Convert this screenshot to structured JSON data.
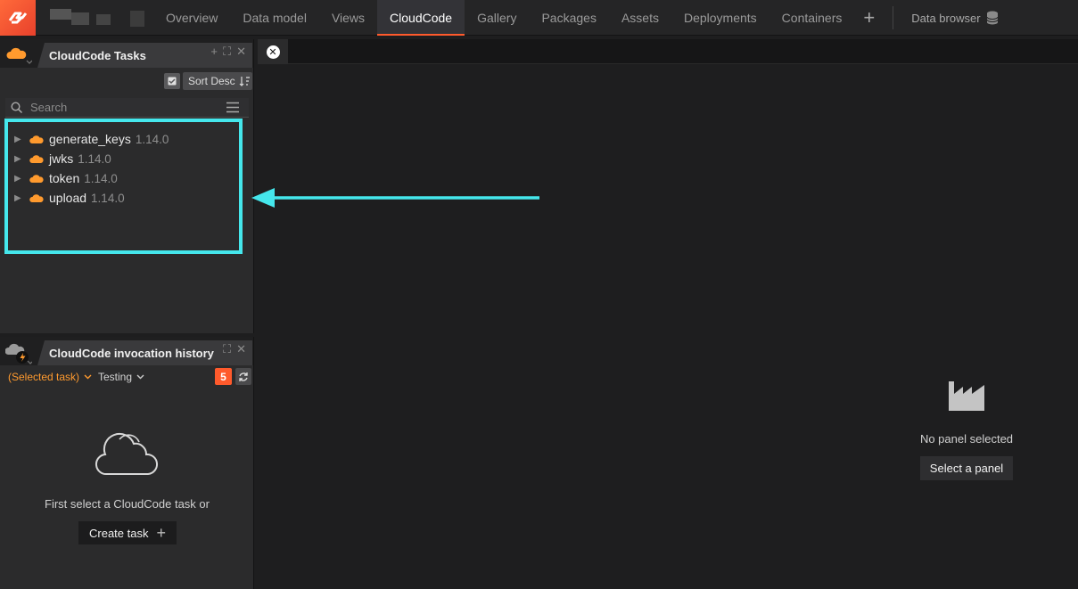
{
  "nav": {
    "tabs": [
      {
        "label": "Overview"
      },
      {
        "label": "Data model"
      },
      {
        "label": "Views"
      },
      {
        "label": "CloudCode"
      },
      {
        "label": "Gallery"
      },
      {
        "label": "Packages"
      },
      {
        "label": "Assets"
      },
      {
        "label": "Deployments"
      },
      {
        "label": "Containers"
      }
    ],
    "active_tab": "CloudCode",
    "add_label": "+",
    "data_browser_label": "Data browser",
    "accent_color": "#ff5a2c"
  },
  "tasks_panel": {
    "title": "CloudCode Tasks",
    "sort_label": "Sort Desc",
    "search_placeholder": "Search",
    "tasks": [
      {
        "name": "generate_keys",
        "version": "1.14.0"
      },
      {
        "name": "jwks",
        "version": "1.14.0"
      },
      {
        "name": "token",
        "version": "1.14.0"
      },
      {
        "name": "upload",
        "version": "1.14.0"
      }
    ],
    "highlight_color": "#45e7ec"
  },
  "history_panel": {
    "title": "CloudCode invocation history",
    "selected_task_label": "(Selected task)",
    "environment_label": "Testing",
    "count_badge": "5",
    "empty_text": "First select a CloudCode task or",
    "create_label": "Create task"
  },
  "main": {
    "empty_title": "No panel selected",
    "select_label": "Select a panel"
  }
}
